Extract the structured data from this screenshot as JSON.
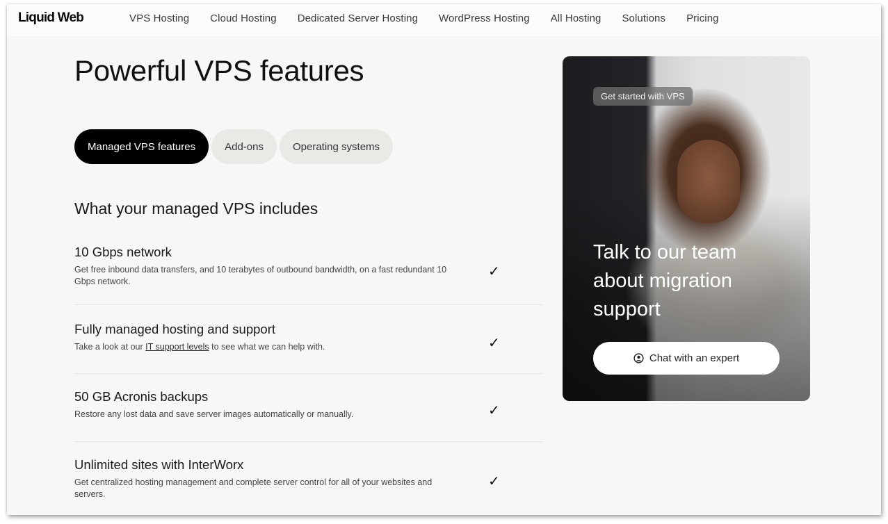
{
  "header": {
    "logo": "Liquid Web",
    "nav": [
      {
        "label": "VPS Hosting"
      },
      {
        "label": "Cloud Hosting"
      },
      {
        "label": "Dedicated Server Hosting"
      },
      {
        "label": "WordPress Hosting"
      },
      {
        "label": "All Hosting"
      },
      {
        "label": "Solutions"
      },
      {
        "label": "Pricing"
      }
    ]
  },
  "main": {
    "title": "Powerful VPS features",
    "tabs": [
      {
        "label": "Managed VPS features",
        "active": true
      },
      {
        "label": "Add-ons",
        "active": false
      },
      {
        "label": "Operating systems",
        "active": false
      }
    ],
    "subtitle": "What your managed VPS includes",
    "features": [
      {
        "title": "10 Gbps network",
        "description": "Get free inbound data transfers, and 10 terabytes of outbound bandwidth, on a fast redundant 10 Gbps network.",
        "included": true
      },
      {
        "title": "Fully managed hosting and support",
        "description_before": "Take a look at our ",
        "description_link": "IT support levels",
        "description_after": " to see what we can help with.",
        "included": true
      },
      {
        "title": "50 GB Acronis backups",
        "description": "Restore any lost data and save server images automatically or manually.",
        "included": true
      },
      {
        "title": "Unlimited sites with InterWorx",
        "description": "Get centralized hosting management and complete server control for all of your websites and servers.",
        "included": true
      }
    ],
    "check_glyph": "✓"
  },
  "promo_card": {
    "badge": "Get started with VPS",
    "heading": "Talk to our team about migration support",
    "button_label": "Chat with an expert",
    "button_icon": "user-circle-icon"
  }
}
